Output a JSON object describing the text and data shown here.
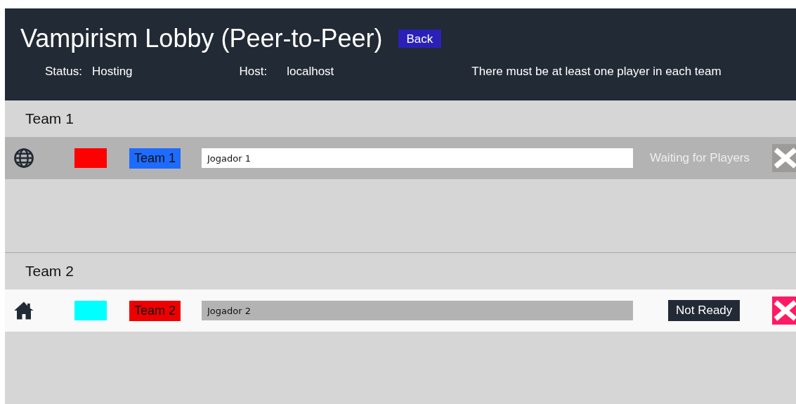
{
  "title": "Vampirism Lobby (Peer-to-Peer)",
  "back_button": "Back",
  "status": {
    "label": "Status:",
    "value": "Hosting"
  },
  "host": {
    "label": "Host:",
    "value": "localhost"
  },
  "message": "There must be at least one player in each team",
  "teams": [
    {
      "name": "Team 1",
      "players": [
        {
          "kind": "remote",
          "color": "#ff0000",
          "team": {
            "label": "Team 1",
            "color": "#1e6bff"
          },
          "name": "Jogador 1",
          "status": {
            "kind": "label",
            "text": "Waiting for Players"
          }
        }
      ]
    },
    {
      "name": "Team 2",
      "players": [
        {
          "kind": "local",
          "color": "#00ffff",
          "team": {
            "label": "Team 2",
            "color": "#ee0000"
          },
          "name": "Jogador 2",
          "status": {
            "kind": "button",
            "text": "Not Ready"
          }
        }
      ]
    }
  ]
}
